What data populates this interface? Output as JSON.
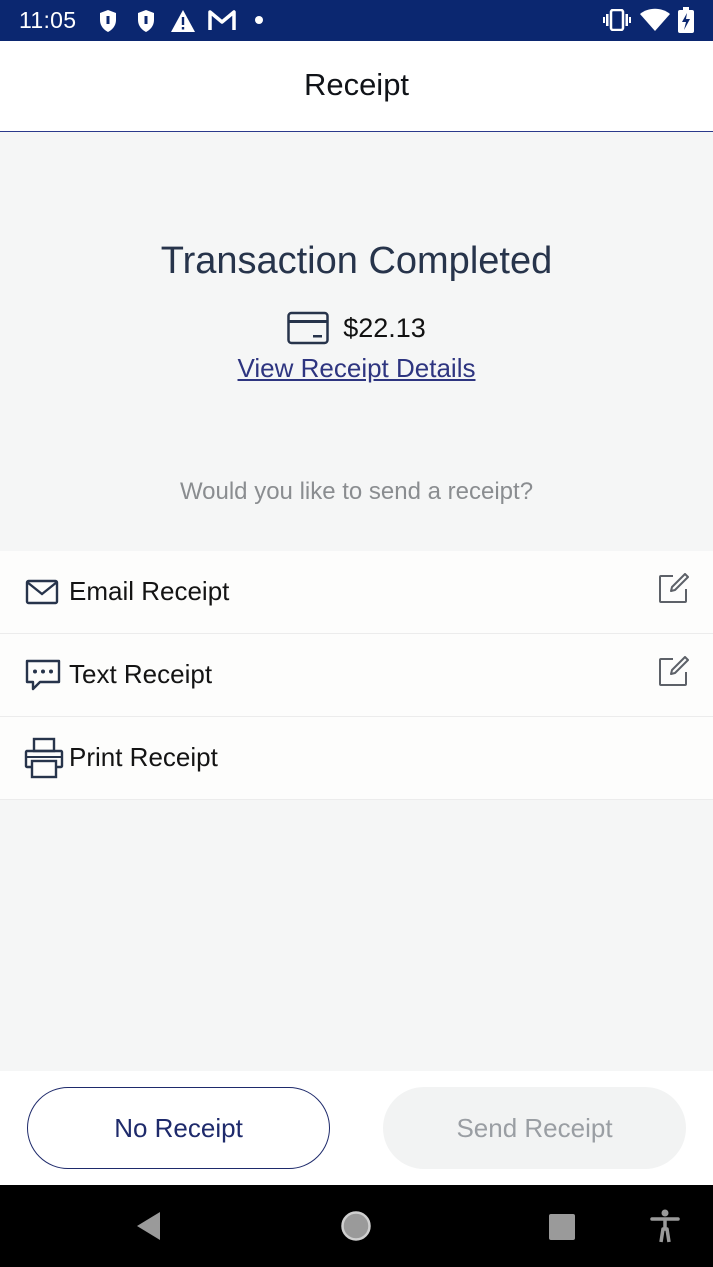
{
  "status_bar": {
    "time": "11:05",
    "left_icons": [
      "shield-icon",
      "shield-icon",
      "warning-icon",
      "gmail-icon",
      "dot-icon"
    ],
    "right_icons": [
      "vibrate-icon",
      "wifi-icon",
      "battery-charging-icon"
    ]
  },
  "header": {
    "title": "Receipt"
  },
  "transaction": {
    "title": "Transaction Completed",
    "payment_icon": "credit-card-icon",
    "amount": "$22.13",
    "details_link": "View Receipt Details"
  },
  "prompt": "Would you like to send a receipt?",
  "options": [
    {
      "label": "Email Receipt",
      "icon": "envelope-icon",
      "editable": true
    },
    {
      "label": "Text Receipt",
      "icon": "chat-bubble-icon",
      "editable": true
    },
    {
      "label": "Print Receipt",
      "icon": "printer-icon",
      "editable": false
    }
  ],
  "buttons": {
    "no_receipt": "No Receipt",
    "send_receipt": "Send Receipt"
  },
  "nav_bar": {
    "icons": [
      "back-icon",
      "home-icon",
      "recents-icon",
      "accessibility-icon"
    ]
  },
  "colors": {
    "status_bar": "#0b2770",
    "accent": "#1e2a6b",
    "title_text": "#27344b",
    "link": "#2e3580",
    "muted_text": "#8a8d90",
    "background": "#f5f6f6"
  }
}
